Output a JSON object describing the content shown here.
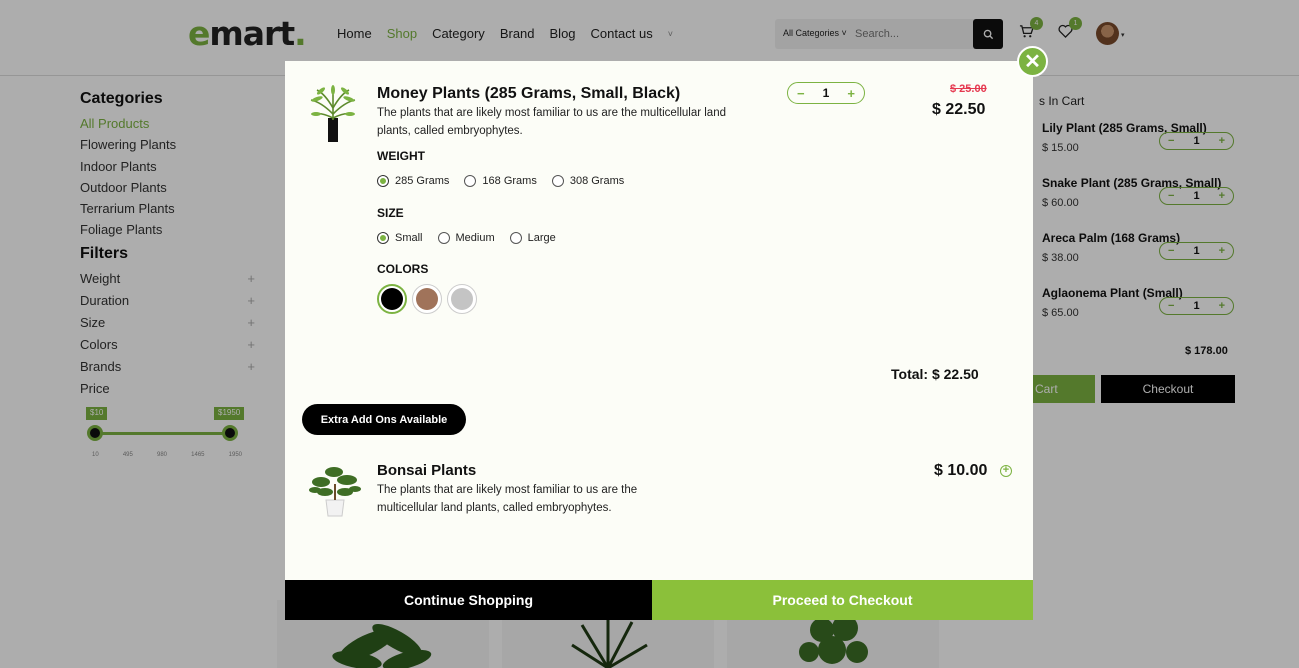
{
  "header": {
    "logo_e": "e",
    "logo_rest": "mart",
    "logo_dot": ".",
    "nav": [
      "Home",
      "Shop",
      "Category",
      "Brand",
      "Blog",
      "Contact us"
    ],
    "nav_more": "˅",
    "search_category": "All Categories ˅",
    "search_placeholder": "Search...",
    "cart_count": "4",
    "wishlist_count": "1",
    "avatar_caret": "▾"
  },
  "sidebar": {
    "categories_title": "Categories",
    "categories": [
      "All Products",
      "Flowering Plants",
      "Indoor Plants",
      "Outdoor Plants",
      "Terrarium Plants",
      "Foliage Plants"
    ],
    "filters_title": "Filters",
    "filters": [
      "Weight",
      "Duration",
      "Size",
      "Colors",
      "Brands"
    ],
    "filter_plus": "+",
    "price_label": "Price",
    "price_min": "$10",
    "price_max": "$1950",
    "ticks": [
      "10",
      "495",
      "980",
      "1465",
      "1950"
    ],
    "price_range_fraction": [
      0,
      1
    ]
  },
  "cart_panel": {
    "title": "s In Cart",
    "items": [
      {
        "name": "Lily Plant (285 Grams, Small)",
        "price": "$ 15.00",
        "qty": "1"
      },
      {
        "name": "Snake Plant (285 Grams, Small)",
        "price": "$ 60.00",
        "qty": "1"
      },
      {
        "name": "Areca Palm (168 Grams)",
        "price": "$ 38.00",
        "qty": "1"
      },
      {
        "name": "Aglaonema Plant (Small)",
        "price": "$ 65.00",
        "qty": "1"
      }
    ],
    "minus": "−",
    "plus": "+",
    "subtotal": "$ 178.00",
    "cart_btn": "Cart",
    "checkout_btn": "Checkout"
  },
  "modal": {
    "close": "✕",
    "product": {
      "name": "Money Plants (285 Grams, Small, Black)",
      "description": "The plants that are likely most familiar to us are the multicellular land plants, called embryophytes.",
      "qty": "1",
      "minus": "−",
      "plus": "+",
      "old_price": "$ 25.00",
      "price": "$ 22.50"
    },
    "weight_label": "WEIGHT",
    "weights": [
      {
        "label": "285 Grams",
        "selected": true
      },
      {
        "label": "168 Grams",
        "selected": false
      },
      {
        "label": "308 Grams",
        "selected": false
      }
    ],
    "size_label": "SIZE",
    "sizes": [
      {
        "label": "Small",
        "selected": true
      },
      {
        "label": "Medium",
        "selected": false
      },
      {
        "label": "Large",
        "selected": false
      }
    ],
    "colors_label": "COLORS",
    "colors": [
      {
        "hex": "#000000",
        "selected": true
      },
      {
        "hex": "#a0735a",
        "selected": false
      },
      {
        "hex": "#c4c4c4",
        "selected": false
      }
    ],
    "total": "Total: $ 22.50",
    "addons_pill": "Extra Add Ons Available",
    "addon": {
      "name": "Bonsai Plants",
      "description": "The plants that are likely most familiar to us are the multicellular land plants, called embryophytes.",
      "price": "$ 10.00",
      "add_icon": "+"
    },
    "continue_btn": "Continue Shopping",
    "proceed_btn": "Proceed to Checkout"
  },
  "colors": {
    "accent": "#7cb342",
    "proceed": "#8bc03a",
    "old_price": "#e53950"
  }
}
